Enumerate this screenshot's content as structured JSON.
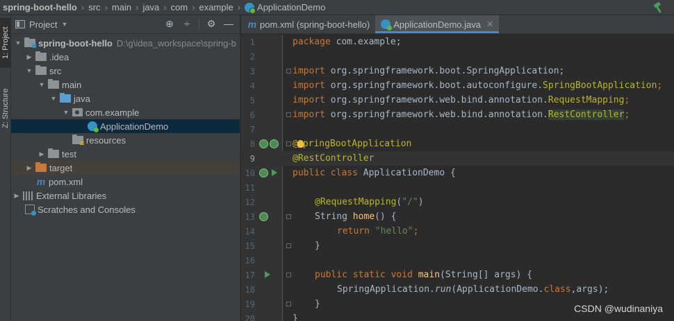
{
  "breadcrumbs": [
    {
      "label": "spring-boot-hello",
      "bold": true
    },
    {
      "label": "src"
    },
    {
      "label": "main"
    },
    {
      "label": "java"
    },
    {
      "label": "com"
    },
    {
      "label": "example"
    },
    {
      "label": "ApplicationDemo"
    }
  ],
  "left_strip": {
    "project_tab": "1: Project",
    "structure_tab": "Z: Structure"
  },
  "project_panel": {
    "title": "Project",
    "tree": [
      {
        "label": "spring-boot-hello",
        "path": "D:\\g\\idea_workspace\\spring-b",
        "bold": true
      },
      {
        "label": ".idea"
      },
      {
        "label": "src"
      },
      {
        "label": "main"
      },
      {
        "label": "java"
      },
      {
        "label": "com.example"
      },
      {
        "label": "ApplicationDemo"
      },
      {
        "label": "resources"
      },
      {
        "label": "test"
      },
      {
        "label": "target"
      },
      {
        "label": "pom.xml"
      },
      {
        "label": "External Libraries"
      },
      {
        "label": "Scratches and Consoles"
      }
    ]
  },
  "tabs": [
    {
      "label": "pom.xml (spring-boot-hello)",
      "active": false
    },
    {
      "label": "ApplicationDemo.java",
      "active": true
    }
  ],
  "code": {
    "line_numbers": [
      "1",
      "2",
      "3",
      "4",
      "5",
      "6",
      "7",
      "8",
      "9",
      "10",
      "11",
      "12",
      "13",
      "14",
      "15",
      "16",
      "17",
      "18",
      "19",
      "20"
    ],
    "l1_kw": "package",
    "l1_rest": " com.example;",
    "imp_kw": "import",
    "l3": " org.springframework.boot.SpringApplication;",
    "l4_a": " org.springframework.boot.autoconfigure.",
    "l4_b": "SpringBootApplication",
    "l5_a": " org.springframework.web.bind.annotation.",
    "l5_b": "RequestMapping",
    "l6_a": " org.springframework.web.bind.annotation.",
    "l6_b": "RestController",
    "semi": ";",
    "l8_a": "@",
    "l8_b": "pringBootApplication",
    "l9": "@RestController",
    "l10_kw": "public class",
    "l10_rest": " ApplicationDemo {",
    "l12_ann": "@RequestMapping",
    "l12_open": "(",
    "l12_str": "\"/\"",
    "l12_close": ")",
    "l13_a": "String ",
    "l13_fn": "home",
    "l13_b": "() {",
    "l14_kw": "return",
    "l14_str": " \"hello\"",
    "l14_semi": ";",
    "brace": "}",
    "l17_kw": "public static void",
    "l17_fn": " main",
    "l17_rest": "(String[] args) {",
    "l18_a": "SpringApplication.",
    "l18_run": "run",
    "l18_b": "(ApplicationDemo.",
    "l18_kw": "class",
    "l18_c": ",args);"
  },
  "watermark": "CSDN @wudinaniya",
  "colors": {
    "keyword": "#cc7832",
    "annotation": "#bbb529",
    "string": "#6a8759",
    "method": "#ffc66d",
    "text": "#a9b7c6",
    "accent": "#4a88c7"
  }
}
